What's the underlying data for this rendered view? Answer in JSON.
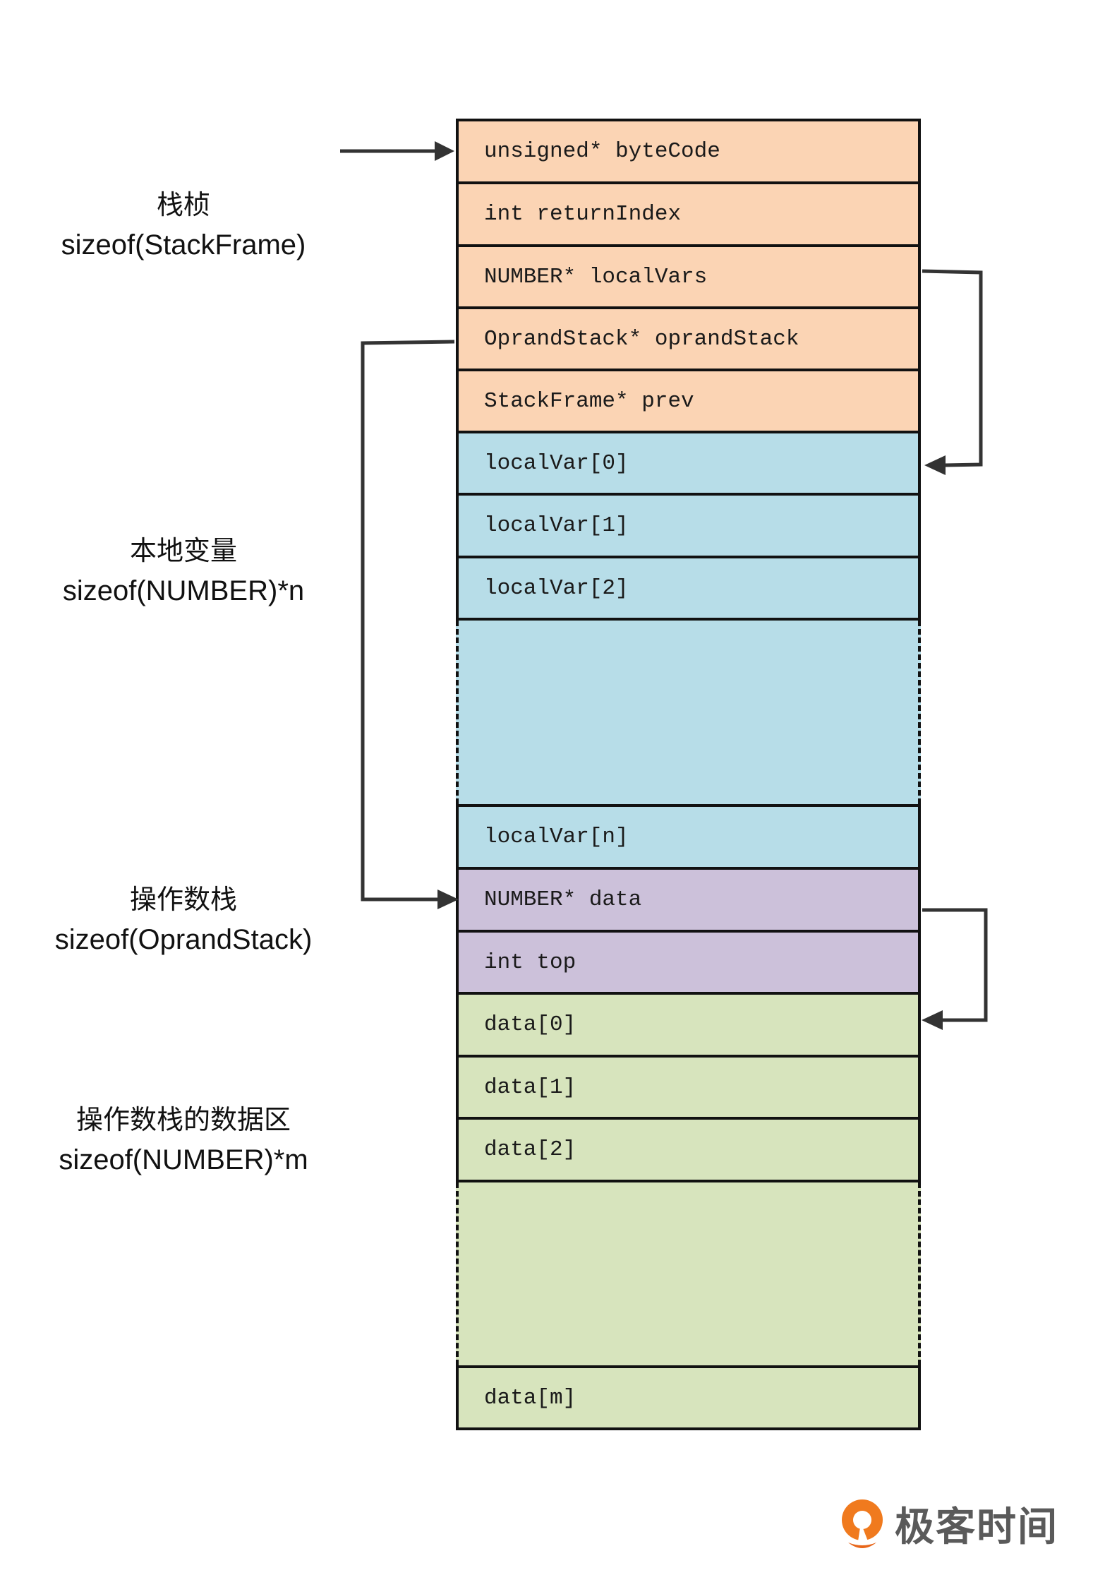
{
  "colors": {
    "frame_header": "#fbd4b4",
    "local_vars": "#b7dde8",
    "oprand_stack": "#ccc1da",
    "stack_data": "#d7e4bd",
    "border": "#111111",
    "arrow": "#333333",
    "logo_orange": "#f07a1e",
    "logo_text": "#5a5a5a"
  },
  "labels": [
    {
      "cn": "栈桢",
      "size": "sizeof(StackFrame)"
    },
    {
      "cn": "本地变量",
      "size": "sizeof(NUMBER)*n"
    },
    {
      "cn": "操作数栈",
      "size": "sizeof(OprandStack)"
    },
    {
      "cn": "操作数栈的数据区",
      "size": "sizeof(NUMBER)*m"
    }
  ],
  "frame": {
    "header_fields": [
      "unsigned* byteCode",
      "int returnIndex",
      "NUMBER* localVars",
      "OprandStack* oprandStack",
      "StackFrame* prev"
    ],
    "local_vars": [
      "localVar[0]",
      "localVar[1]",
      "localVar[2]"
    ],
    "local_var_last": "localVar[n]",
    "oprand_stack_fields": [
      "NUMBER* data",
      "int top"
    ],
    "data_items": [
      "data[0]",
      "data[1]",
      "data[2]"
    ],
    "data_last": "data[m]"
  },
  "pointers": [
    {
      "name": "entry-pointer",
      "to": "unsigned* byteCode"
    },
    {
      "name": "localVars-pointer",
      "from": "NUMBER* localVars",
      "to": "localVar[0]"
    },
    {
      "name": "oprandStack-pointer",
      "from": "OprandStack* oprandStack",
      "to": "NUMBER* data"
    },
    {
      "name": "data-pointer",
      "from": "NUMBER* data",
      "to": "data[0]"
    }
  ],
  "logo": {
    "text": "极客时间"
  }
}
